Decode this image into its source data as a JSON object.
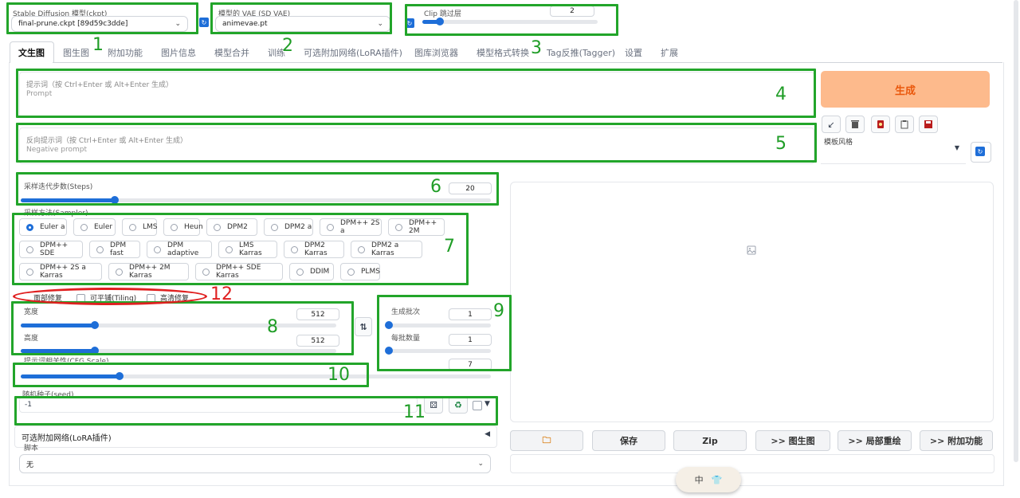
{
  "header": {
    "checkpoint": {
      "label": "Stable Diffusion 模型(ckpt)",
      "value": "final-prune.ckpt [89d59c3dde]"
    },
    "vae": {
      "label": "模型的 VAE (SD VAE)",
      "value": "animevae.pt"
    },
    "clip": {
      "label": "Clip 跳过层",
      "value": "2",
      "fraction": 0.1
    }
  },
  "tabs": [
    "文生图",
    "图生图",
    "附加功能",
    "图片信息",
    "模型合并",
    "训练",
    "可选附加网络(LoRA插件)",
    "图库浏览器",
    "模型格式转换",
    "Tag反推(Tagger)",
    "设置",
    "扩展"
  ],
  "prompt": {
    "hint": "提示词（按 Ctrl+Enter 或 Alt+Enter 生成）",
    "placeholder": "Prompt"
  },
  "negative": {
    "hint": "反向提示词（按 Ctrl+Enter 或 Alt+Enter 生成）",
    "placeholder": "Negative prompt"
  },
  "generate_label": "生成",
  "template_label": "模板风格",
  "steps": {
    "label": "采样迭代步数(Steps)",
    "value": "20",
    "fraction": 0.2
  },
  "sampler": {
    "label": "采样方法(Sampler)",
    "selected": "Euler a",
    "rows": [
      [
        "Euler a",
        "Euler",
        "LMS",
        "Heun",
        "DPM2",
        "DPM2 a",
        "DPM++ 2S a",
        "DPM++ 2M"
      ],
      [
        "DPM++ SDE",
        "DPM fast",
        "DPM adaptive",
        "LMS Karras",
        "DPM2 Karras",
        "DPM2 a Karras"
      ],
      [
        "DPM++ 2S a Karras",
        "DPM++ 2M Karras",
        "DPM++ SDE Karras",
        "DDIM",
        "PLMS"
      ]
    ]
  },
  "options": {
    "face_restore": "面部修复",
    "tiling": "可平铺(Tiling)",
    "hires": "高清修复"
  },
  "width": {
    "label": "宽度",
    "value": "512",
    "fraction": 0.235
  },
  "height": {
    "label": "高度",
    "value": "512",
    "fraction": 0.235
  },
  "batch_count": {
    "label": "生成批次",
    "value": "1",
    "fraction": 0.0
  },
  "batch_size": {
    "label": "每批数量",
    "value": "1",
    "fraction": 0.0
  },
  "cfg": {
    "label": "提示词相关性(CFG Scale)",
    "value": "7",
    "fraction": 0.21
  },
  "seed": {
    "label": "随机种子(seed)",
    "value": "-1"
  },
  "lora_panel": "可选附加网络(LoRA插件)",
  "script": {
    "label": "脚本",
    "value": "无"
  },
  "output_buttons": [
    "保存",
    "Zip",
    ">> 图生图",
    ">> 局部重绘",
    ">> 附加功能"
  ],
  "annotations": [
    "1",
    "2",
    "3",
    "4",
    "5",
    "6",
    "7",
    "8",
    "9",
    "10",
    "11",
    "12"
  ],
  "ime": {
    "label": "中"
  },
  "colors": {
    "accent": "#1e6ed8",
    "annotation_green": "#22a52a",
    "annotation_red": "#e02020",
    "generate_bg": "#fdba8c"
  }
}
